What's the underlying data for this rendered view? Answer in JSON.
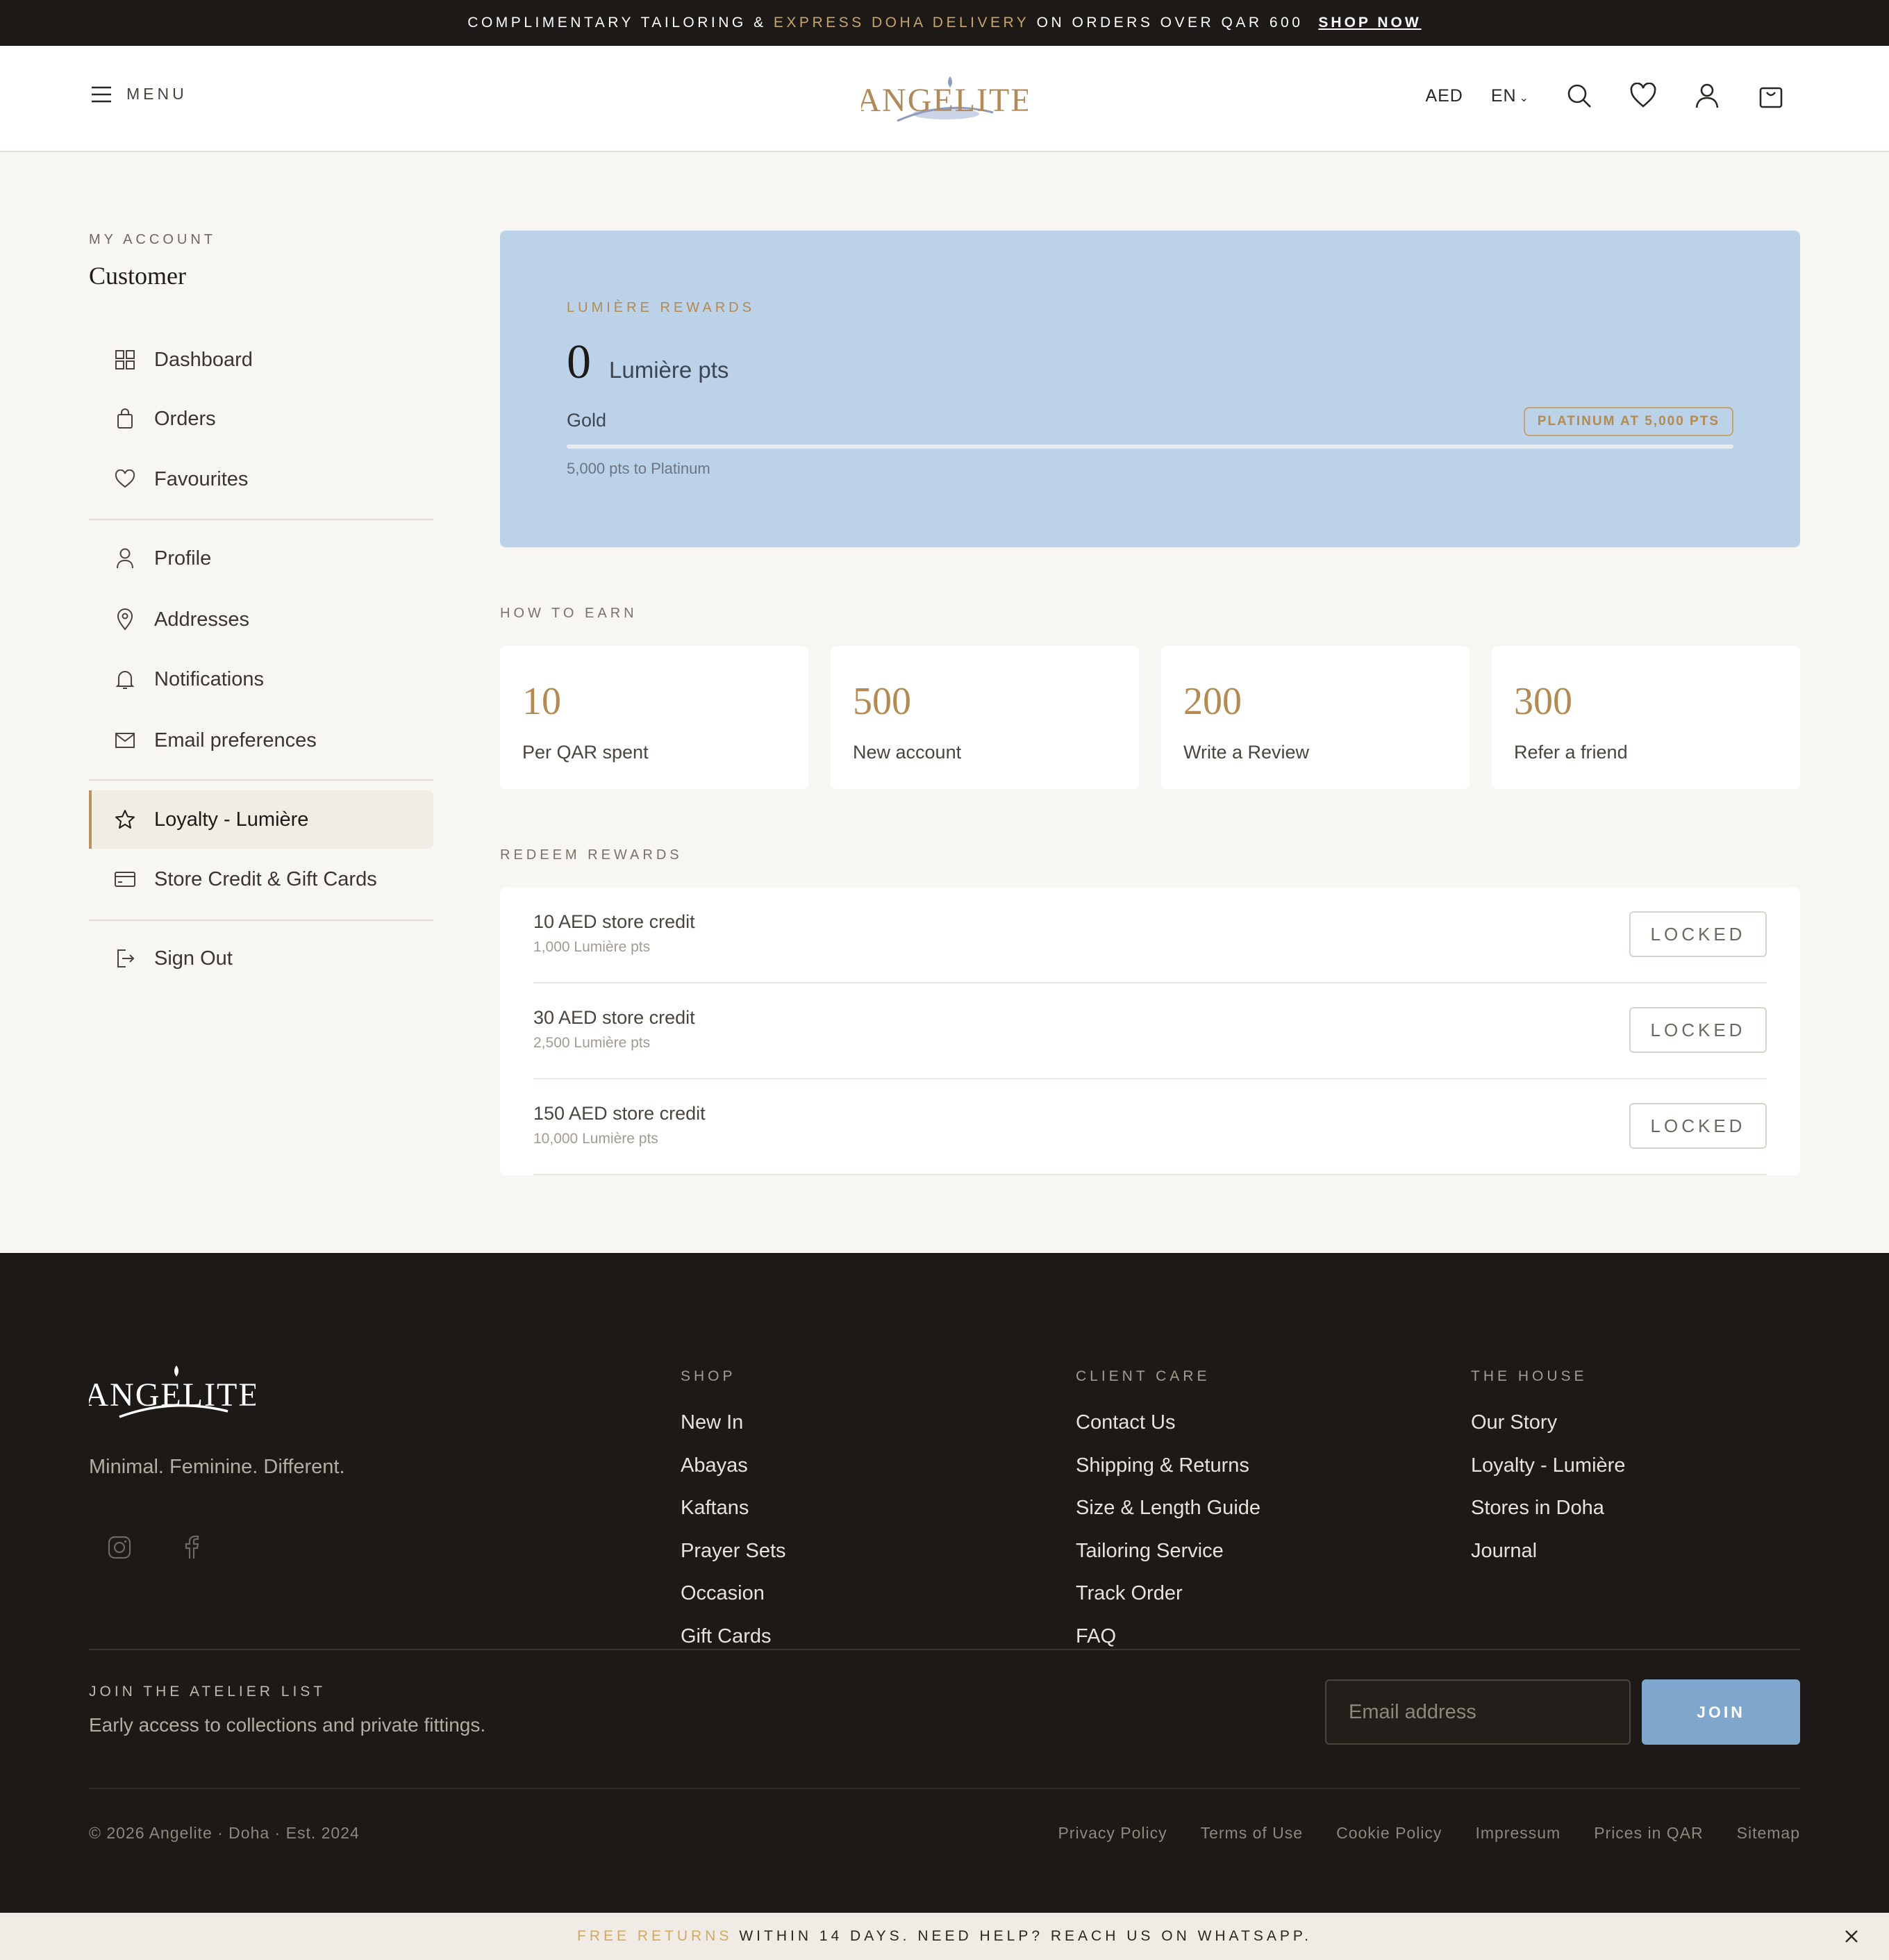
{
  "announcement": {
    "pre": "COMPLIMENTARY TAILORING & ",
    "accent": "EXPRESS DOHA DELIVERY",
    "post": " ON ORDERS OVER QAR 600",
    "cta": "SHOP NOW"
  },
  "header": {
    "menu_label": "MENU",
    "logo_text": "ANGELITE",
    "currency": "AED",
    "language": "EN"
  },
  "sidebar": {
    "kicker": "MY ACCOUNT",
    "name": "Customer",
    "items": [
      {
        "label": "Dashboard",
        "icon": "grid-icon"
      },
      {
        "label": "Orders",
        "icon": "bag-icon"
      },
      {
        "label": "Favourites",
        "icon": "heart-icon"
      },
      {
        "label": "Profile",
        "icon": "user-icon"
      },
      {
        "label": "Addresses",
        "icon": "pin-icon"
      },
      {
        "label": "Notifications",
        "icon": "bell-icon"
      },
      {
        "label": "Email preferences",
        "icon": "mail-icon"
      },
      {
        "label": "Loyalty - Lumière",
        "icon": "star-icon",
        "active": true
      },
      {
        "label": "Store Credit & Gift Cards",
        "icon": "card-icon"
      },
      {
        "label": "Sign Out",
        "icon": "logout-icon"
      }
    ]
  },
  "rewards": {
    "kicker": "LUMIÈRE REWARDS",
    "points": "0",
    "points_unit": "Lumière pts",
    "tier": "Gold",
    "next_tier_badge": "PLATINUM AT 5,000 PTS",
    "progress_percent": 0,
    "progress_text": "5,000 pts to Platinum"
  },
  "earn": {
    "kicker": "HOW TO EARN",
    "cards": [
      {
        "value": "10",
        "label": "Per QAR spent"
      },
      {
        "value": "500",
        "label": "New account"
      },
      {
        "value": "200",
        "label": "Write a Review"
      },
      {
        "value": "300",
        "label": "Refer a friend"
      }
    ]
  },
  "redeem": {
    "kicker": "REDEEM REWARDS",
    "items": [
      {
        "title": "10 AED store credit",
        "cost": "1,000 Lumière pts",
        "status": "LOCKED"
      },
      {
        "title": "30 AED store credit",
        "cost": "2,500 Lumière pts",
        "status": "LOCKED"
      },
      {
        "title": "150 AED store credit",
        "cost": "10,000 Lumière pts",
        "status": "LOCKED"
      }
    ]
  },
  "footer": {
    "logo_text": "ANGELITE",
    "tagline": "Minimal. Feminine. Different.",
    "columns": [
      {
        "heading": "SHOP",
        "links": [
          "New In",
          "Abayas",
          "Kaftans",
          "Prayer Sets",
          "Occasion",
          "Gift Cards"
        ]
      },
      {
        "heading": "CLIENT CARE",
        "links": [
          "Contact Us",
          "Shipping & Returns",
          "Size & Length Guide",
          "Tailoring Service",
          "Track Order",
          "FAQ"
        ]
      },
      {
        "heading": "THE HOUSE",
        "links": [
          "Our Story",
          "Loyalty - Lumière",
          "Stores in Doha",
          "Journal"
        ]
      }
    ],
    "newsletter": {
      "kicker": "JOIN THE ATELIER LIST",
      "subtitle": "Early access to collections and private fittings.",
      "placeholder": "Email address",
      "button": "JOIN"
    },
    "copyright": "© 2026 Angelite · Doha · Est. 2024",
    "legal_links": [
      "Privacy Policy",
      "Terms of Use",
      "Cookie Policy",
      "Impressum",
      "Prices in QAR",
      "Sitemap"
    ]
  },
  "bottom_bar": {
    "accent": "FREE RETURNS",
    "text": "WITHIN 14 DAYS. NEED HELP? REACH US ON WHATSAPP."
  },
  "colors": {
    "accent_gold": "#b8935c",
    "hero_blue": "#bcd2e8",
    "join_blue": "#7fa6cd",
    "dark": "#1c1916"
  }
}
